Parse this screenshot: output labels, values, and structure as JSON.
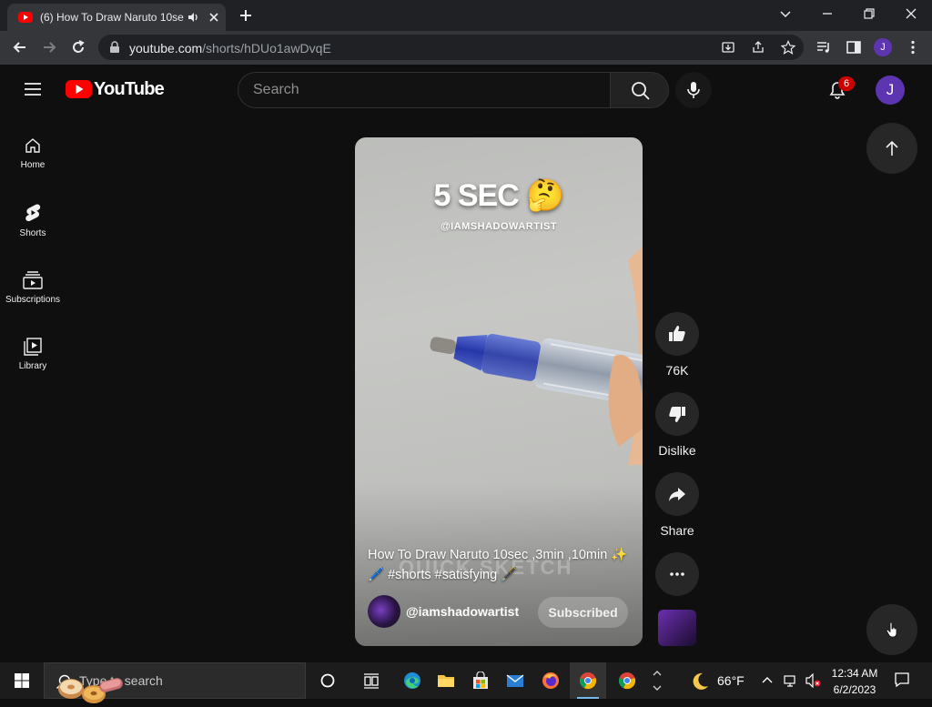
{
  "browser": {
    "tab_title": "(6) How To Draw Naruto 10sec ,3min ,10min",
    "url_host": "youtube.com",
    "url_path": "/shorts/hDUo1awDvqE",
    "profile_initial": "J"
  },
  "header": {
    "logo_text": "YouTube",
    "search_placeholder": "Search",
    "notification_count": "6",
    "avatar_initial": "J"
  },
  "sidebar": {
    "items": [
      {
        "label": "Home",
        "icon": "home-icon"
      },
      {
        "label": "Shorts",
        "icon": "shorts-icon"
      },
      {
        "label": "Subscriptions",
        "icon": "subscriptions-icon"
      },
      {
        "label": "Library",
        "icon": "library-icon"
      }
    ]
  },
  "video": {
    "overlay_title": "5 SEC 🤔",
    "overlay_handle": "@IAMSHADOWARTIST",
    "watermark": "QUICK SKETCH",
    "title": "How To Draw Naruto 10sec ,3min ,10min ✨🖊️ #shorts #satisfying 🖋️",
    "channel": "@iamshadowartist",
    "subscribe_label": "Subscribed"
  },
  "actions": {
    "like_count": "76K",
    "dislike_label": "Dislike",
    "share_label": "Share"
  },
  "taskbar": {
    "search_placeholder": "Type to search",
    "temperature": "66°F",
    "time": "12:34 AM",
    "date": "6/2/2023"
  },
  "colors": {
    "brand_red": "#ff0000",
    "background": "#0f0f0f",
    "badge_red": "#cc0000",
    "avatar_purple": "#5e35b1"
  }
}
